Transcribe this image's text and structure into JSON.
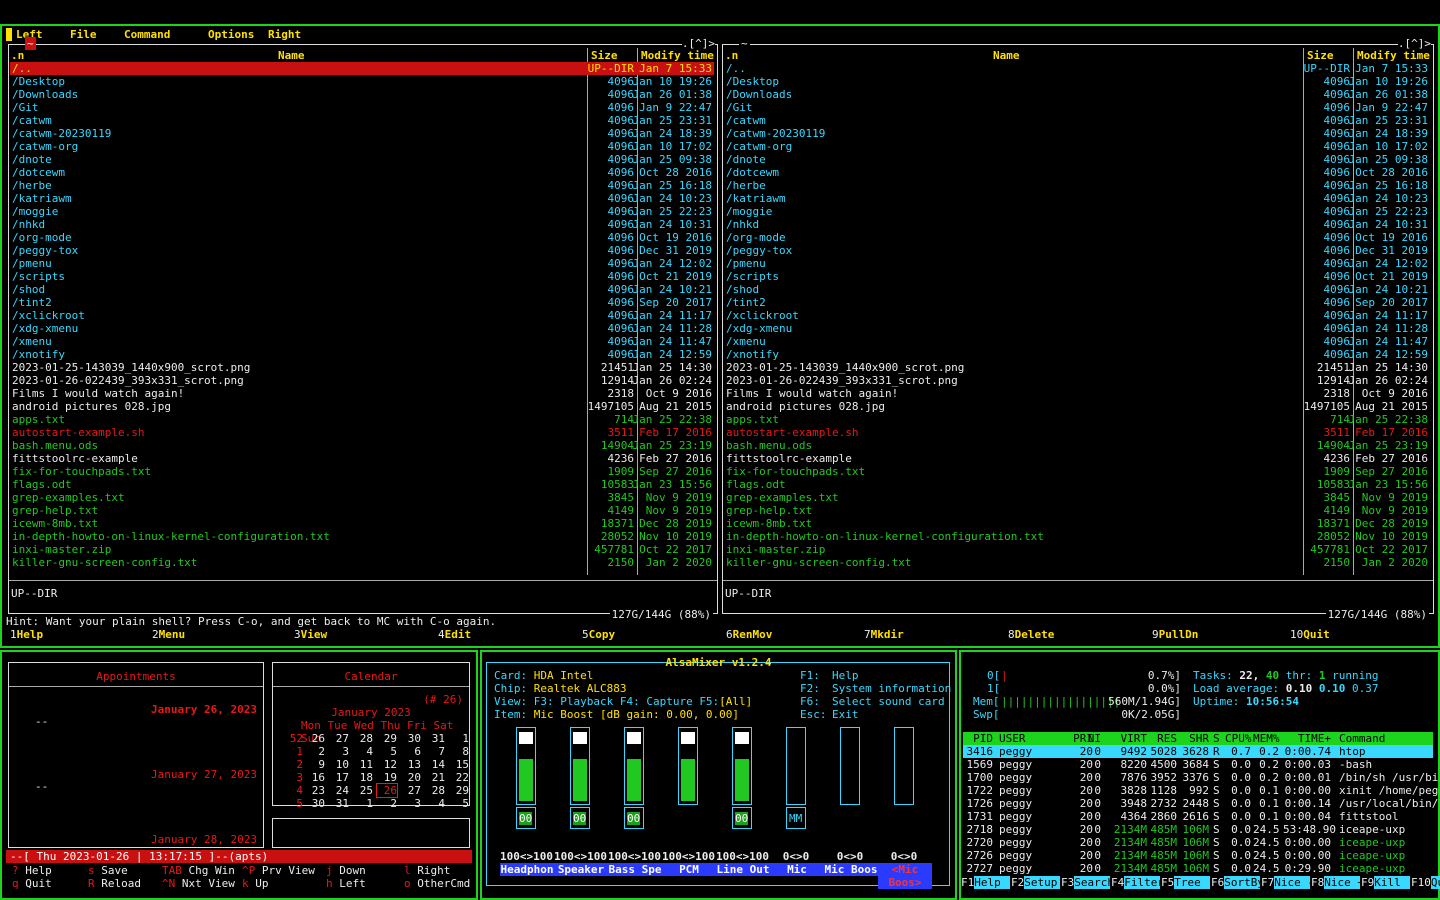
{
  "mc": {
    "menu": [
      "Left",
      "File",
      "Command",
      "Options",
      "Right"
    ],
    "left_path": "~",
    "right_path": "~",
    "corner_marks": ".[^]>",
    "col_name": "Name",
    "col_size": "Size",
    "col_time": "Modify time",
    "col_n": ".n",
    "files": [
      {
        "n": "/..",
        "s": "UP--DIR",
        "t": "Jan  7 15:33",
        "c": "cy",
        "sel": true
      },
      {
        "n": "/Desktop",
        "s": "4096",
        "t": "Jan 10 19:26",
        "c": "cy"
      },
      {
        "n": "/Downloads",
        "s": "4096",
        "t": "Jan 26 01:38",
        "c": "cy"
      },
      {
        "n": "/Git",
        "s": "4096",
        "t": "Jan  9 22:47",
        "c": "cy"
      },
      {
        "n": "/catwm",
        "s": "4096",
        "t": "Jan 25 23:31",
        "c": "cy"
      },
      {
        "n": "/catwm-20230119",
        "s": "4096",
        "t": "Jan 24 18:39",
        "c": "cy"
      },
      {
        "n": "/catwm-org",
        "s": "4096",
        "t": "Jan 10 17:02",
        "c": "cy"
      },
      {
        "n": "/dnote",
        "s": "4096",
        "t": "Jan 25 09:38",
        "c": "cy"
      },
      {
        "n": "/dotcewm",
        "s": "4096",
        "t": "Oct 28  2016",
        "c": "cy"
      },
      {
        "n": "/herbe",
        "s": "4096",
        "t": "Jan 25 16:18",
        "c": "cy"
      },
      {
        "n": "/katriawm",
        "s": "4096",
        "t": "Jan 24 10:23",
        "c": "cy"
      },
      {
        "n": "/moggie",
        "s": "4096",
        "t": "Jan 25 22:23",
        "c": "cy"
      },
      {
        "n": "/nhkd",
        "s": "4096",
        "t": "Jan 24 10:31",
        "c": "cy"
      },
      {
        "n": "/org-mode",
        "s": "4096",
        "t": "Oct 19  2016",
        "c": "cy"
      },
      {
        "n": "/peggy-tox",
        "s": "4096",
        "t": "Dec 31  2019",
        "c": "cy"
      },
      {
        "n": "/pmenu",
        "s": "4096",
        "t": "Jan 24 12:02",
        "c": "cy"
      },
      {
        "n": "/scripts",
        "s": "4096",
        "t": "Oct 21  2019",
        "c": "cy"
      },
      {
        "n": "/shod",
        "s": "4096",
        "t": "Jan 24 10:21",
        "c": "cy"
      },
      {
        "n": "/tint2",
        "s": "4096",
        "t": "Sep 20  2017",
        "c": "cy"
      },
      {
        "n": "/xclickroot",
        "s": "4096",
        "t": "Jan 24 11:17",
        "c": "cy"
      },
      {
        "n": "/xdg-xmenu",
        "s": "4096",
        "t": "Jan 24 11:28",
        "c": "cy"
      },
      {
        "n": "/xmenu",
        "s": "4096",
        "t": "Jan 24 11:47",
        "c": "cy"
      },
      {
        "n": "/xnotify",
        "s": "4096",
        "t": "Jan 24 12:59",
        "c": "cy"
      },
      {
        "n": " 2023-01-25-143039_1440x900_scrot.png",
        "s": "21451",
        "t": "Jan 25 14:30",
        "c": "wh"
      },
      {
        "n": " 2023-01-26-022439_393x331_scrot.png",
        "s": "12914",
        "t": "Jan 26 02:24",
        "c": "wh"
      },
      {
        "n": " Films I would watch again!",
        "s": "2318",
        "t": "Oct  9  2016",
        "c": "wh"
      },
      {
        "n": " android pictures 028.jpg",
        "s": "1497105",
        "t": "Aug 21  2015",
        "c": "wh"
      },
      {
        "n": " apps.txt",
        "s": "714",
        "t": "Jan 25 22:38",
        "c": "gr"
      },
      {
        "n": " autostart-example.sh",
        "s": "3511",
        "t": "Feb 17  2016",
        "c": "rd"
      },
      {
        "n": " bash.menu.ods",
        "s": "14904",
        "t": "Jan 25 23:19",
        "c": "gr"
      },
      {
        "n": " fittstoolrc-example",
        "s": "4236",
        "t": "Feb 27  2016",
        "c": "wh"
      },
      {
        "n": " fix-for-touchpads.txt",
        "s": "1909",
        "t": "Sep 27  2016",
        "c": "gr"
      },
      {
        "n": " flags.odt",
        "s": "10583",
        "t": "Jan 23 15:56",
        "c": "gr"
      },
      {
        "n": " grep-examples.txt",
        "s": "3845",
        "t": "Nov  9  2019",
        "c": "gr"
      },
      {
        "n": " grep-help.txt",
        "s": "4149",
        "t": "Nov  9  2019",
        "c": "gr"
      },
      {
        "n": " icewm-8mb.txt",
        "s": "18371",
        "t": "Dec 28  2019",
        "c": "gr"
      },
      {
        "n": " in-depth-howto-on-linux-kernel-configuration.txt",
        "s": "28052",
        "t": "Nov 10  2019",
        "c": "gr"
      },
      {
        "n": " inxi-master.zip",
        "s": "457781",
        "t": "Oct 22  2017",
        "c": "gr"
      },
      {
        "n": " killer-gnu-screen-config.txt",
        "s": "2150",
        "t": "Jan  2  2020",
        "c": "gr"
      }
    ],
    "status": "UP--DIR",
    "disk": "127G/144G (88%)",
    "hint": "Hint: Want your plain shell? Press C-o, and get back to MC with C-o again.",
    "fkeys": [
      [
        "1",
        "Help"
      ],
      [
        "2",
        "Menu"
      ],
      [
        "3",
        "View"
      ],
      [
        "4",
        "Edit"
      ],
      [
        "5",
        "Copy"
      ],
      [
        "6",
        "RenMov"
      ],
      [
        "7",
        "Mkdir"
      ],
      [
        "8",
        "Delete"
      ],
      [
        "9",
        "PullDn"
      ],
      [
        "10",
        "Quit"
      ]
    ]
  },
  "calcurse": {
    "appts_title": "Appointments",
    "cal_title": "Calendar",
    "week": "(# 26)",
    "days": [
      {
        "date": "January 26, 2023",
        "item": "--"
      },
      {
        "date": "January 27, 2023",
        "item": "--"
      },
      {
        "date": "January 28, 2023",
        "item": ""
      }
    ],
    "month": "January 2023",
    "dow": "Mon Tue Wed Thu Fri Sat Sun",
    "weeks": [
      [
        "52",
        "26",
        "27",
        "28",
        "29",
        "30",
        "31",
        "1"
      ],
      [
        "1",
        "2",
        "3",
        "4",
        "5",
        "6",
        "7",
        "8"
      ],
      [
        "2",
        "9",
        "10",
        "11",
        "12",
        "13",
        "14",
        "15"
      ],
      [
        "3",
        "16",
        "17",
        "18",
        "19",
        "20",
        "21",
        "22"
      ],
      [
        "4",
        "23",
        "24",
        "25",
        "26",
        "27",
        "28",
        "29"
      ],
      [
        "5",
        "30",
        "31",
        "1",
        "2",
        "3",
        "4",
        "5"
      ]
    ],
    "statusline": "--[ Thu 2023-01-26 | 13:17:15 ]--(apts)",
    "keys": [
      [
        "?",
        "Help"
      ],
      [
        "s",
        "Save"
      ],
      [
        "TAB",
        "Chg Win"
      ],
      [
        "^P",
        "Prv View"
      ],
      [
        "j",
        "Down"
      ],
      [
        "l",
        "Right"
      ],
      [
        "q",
        "Quit"
      ],
      [
        "R",
        "Reload"
      ],
      [
        "^N",
        "Nxt View"
      ],
      [
        "k",
        "Up"
      ],
      [
        "h",
        "Left"
      ],
      [
        "o",
        "OtherCmd"
      ]
    ]
  },
  "alsa": {
    "title": "AlsaMixer v1.2.4",
    "card_l": "Card:",
    "card": "HDA Intel",
    "chip_l": "Chip:",
    "chip": "Realtek ALC883",
    "view_l": "View:",
    "view": "F3: Playback  F4: Capture  F5:",
    "view_all": "[All]",
    "item_l": "Item:",
    "item": "Mic Boost [dB gain: 0.00, 0.00]",
    "help": [
      [
        "F1:",
        "Help"
      ],
      [
        "F2:",
        "System information"
      ],
      [
        "F6:",
        "Select sound card"
      ],
      [
        "Esc:",
        "Exit"
      ]
    ],
    "channels": [
      {
        "name": "Headphon",
        "val": "100<>100",
        "fill": 0.6,
        "mute": "00",
        "b": true
      },
      {
        "name": "Speaker",
        "val": "100<>100",
        "fill": 0.6,
        "mute": "00",
        "b": true
      },
      {
        "name": "Bass Spe",
        "val": "100<>100",
        "fill": 0.6,
        "mute": "00",
        "b": true
      },
      {
        "name": "PCM",
        "val": "100<>100",
        "fill": 0.6,
        "mute": "",
        "b": false
      },
      {
        "name": "Line Out",
        "val": "100<>100",
        "fill": 0.6,
        "mute": "00",
        "b": true
      },
      {
        "name": "Mic",
        "val": "0<>0",
        "fill": 0,
        "mute": "MM",
        "b": true
      },
      {
        "name": "Mic Boos",
        "val": "0<>0",
        "fill": 0,
        "mute": "",
        "b": false
      },
      {
        "name": "<Mic Boos>",
        "val": "0<>0",
        "fill": 0,
        "mute": "",
        "b": false,
        "sel": true
      }
    ]
  },
  "htop": {
    "cpu0": "0[",
    "cpu0v": "0.7%]",
    "cpu1": "1[",
    "cpu1v": "0.0%]",
    "mem": "Mem[",
    "memv": "560M/1.94G]",
    "swp": "Swp[",
    "swpv": "0K/2.05G]",
    "tasks_l": "Tasks:",
    "tasks": "22,",
    "thr": "40",
    "thr_l": "thr:",
    "running": "1",
    "running_l": "running",
    "load_l": "Load average:",
    "load1": "0.10",
    "load5": "0.10",
    "load15": "0.37",
    "uptime_l": "Uptime:",
    "uptime": "10:56:54",
    "cols": [
      "PID",
      "USER",
      "PRI",
      "NI",
      "VIRT",
      "RES",
      "SHR",
      "S",
      "CPU%",
      "MEM%",
      "TIME+",
      "Command"
    ],
    "procs": [
      [
        "3416",
        "peggy",
        "20",
        "0",
        "9492",
        "5028",
        "3628",
        "R",
        "0.7",
        "0.2",
        "0:00.74",
        "htop"
      ],
      [
        "1569",
        "peggy",
        "20",
        "0",
        "8220",
        "4500",
        "3684",
        "S",
        "0.0",
        "0.2",
        "0:00.03",
        "-bash"
      ],
      [
        "1700",
        "peggy",
        "20",
        "0",
        "7876",
        "3952",
        "3376",
        "S",
        "0.0",
        "0.2",
        "0:00.01",
        "/bin/sh /usr/bi"
      ],
      [
        "1722",
        "peggy",
        "20",
        "0",
        "3828",
        "1128",
        "992",
        "S",
        "0.0",
        "0.1",
        "0:00.00",
        "xinit /home/peg"
      ],
      [
        "1726",
        "peggy",
        "20",
        "0",
        "3948",
        "2732",
        "2448",
        "S",
        "0.0",
        "0.1",
        "0:00.14",
        "/usr/local/bin/"
      ],
      [
        "1731",
        "peggy",
        "20",
        "0",
        "4364",
        "2860",
        "2616",
        "S",
        "0.0",
        "0.1",
        "0:00.04",
        "fittstool"
      ],
      [
        "2718",
        "peggy",
        "20",
        "0",
        "2134M",
        "485M",
        "106M",
        "S",
        "0.0",
        "24.5",
        "53:48.90",
        "iceape-uxp"
      ],
      [
        "2720",
        "peggy",
        "20",
        "0",
        "2134M",
        "485M",
        "106M",
        "S",
        "0.0",
        "24.5",
        "0:00.00",
        "iceape-uxp"
      ],
      [
        "2726",
        "peggy",
        "20",
        "0",
        "2134M",
        "485M",
        "106M",
        "S",
        "0.0",
        "24.5",
        "0:00.00",
        "iceape-uxp"
      ],
      [
        "2727",
        "peggy",
        "20",
        "0",
        "2134M",
        "485M",
        "106M",
        "S",
        "0.0",
        "24.5",
        "0:29.90",
        "iceape-uxp"
      ]
    ],
    "fkeys": [
      [
        "F1",
        "Help"
      ],
      [
        "F2",
        "Setup"
      ],
      [
        "F3",
        "Search"
      ],
      [
        "F4",
        "Filter"
      ],
      [
        "F5",
        "Tree"
      ],
      [
        "F6",
        "SortBy"
      ],
      [
        "F7",
        "Nice -"
      ],
      [
        "F8",
        "Nice +"
      ],
      [
        "F9",
        "Kill"
      ],
      [
        "F10",
        "Quit"
      ]
    ]
  }
}
